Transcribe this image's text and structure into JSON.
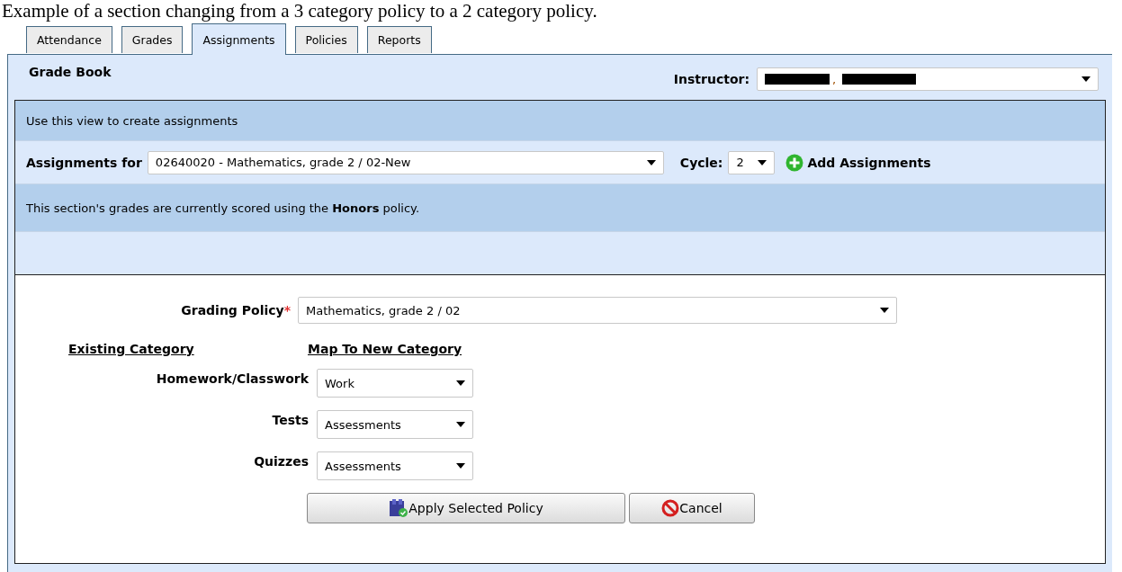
{
  "caption": "Example of a section changing from a 3 category policy to a 2 category policy.",
  "tabs": [
    {
      "label": "Attendance",
      "selected": false
    },
    {
      "label": "Grades",
      "selected": false
    },
    {
      "label": "Assignments",
      "selected": true
    },
    {
      "label": "Policies",
      "selected": false
    },
    {
      "label": "Reports",
      "selected": false
    }
  ],
  "panel_title": "Grade Book",
  "instructor": {
    "label": "Instructor:",
    "separator": ","
  },
  "intro": "Use this view to create assignments",
  "assignments_for": {
    "label": "Assignments for",
    "value": "02640020 - Mathematics, grade 2 / 02-New"
  },
  "cycle": {
    "label": "Cycle:",
    "value": "2"
  },
  "add_button": "Add Assignments",
  "notice": "This section's grades are currently scored using the **Honors** policy.",
  "grading_policy": {
    "label": "Grading Policy",
    "required_mark": "*",
    "value": "Mathematics, grade 2 / 02"
  },
  "mapping_headers": [
    "Existing Category",
    "Map To New Category"
  ],
  "mappings": [
    {
      "category": "Homework/Classwork",
      "value": "Work"
    },
    {
      "category": "Tests",
      "value": "Assessments"
    },
    {
      "category": "Quizzes",
      "value": "Assessments"
    }
  ],
  "buttons": [
    {
      "kind": "apply",
      "label": "Apply Selected Policy"
    },
    {
      "kind": "cancel",
      "label": "Cancel"
    }
  ]
}
